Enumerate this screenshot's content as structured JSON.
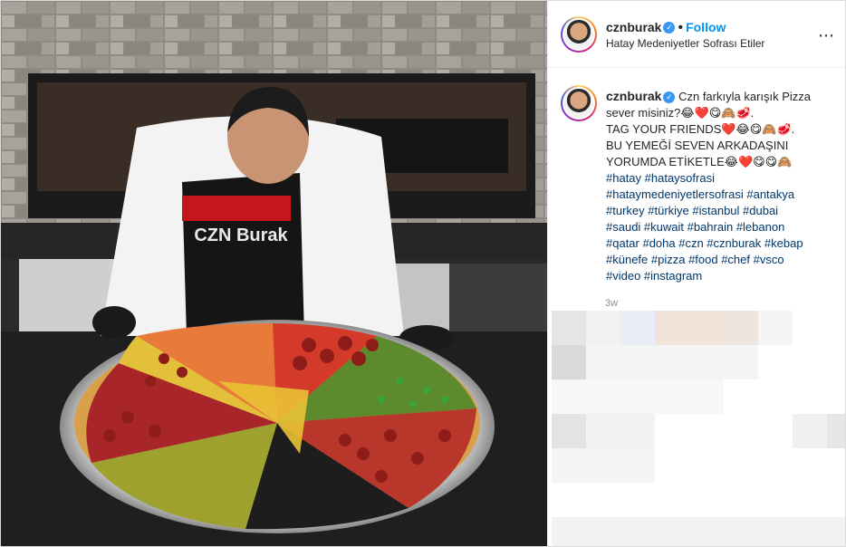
{
  "post": {
    "username": "cznburak",
    "follow_label": "Follow",
    "location": "Hatay Medeniyetler Sofrası Etiler",
    "more_icon": "⋯",
    "caption_lines": [
      "Czn farkıyla karışık Pizza",
      "sever misiniz?😂❤️😋🙈🥩.",
      "TAG YOUR FRIENDS❤️😂😋🙈🥩.",
      "BU YEMEĞİ SEVEN ARKADAŞINI",
      "YORUMDA ETİKETLE😂❤️😋😋🙈"
    ],
    "hashtag_lines": [
      "#hatay #hataysofrasi",
      "#hataymedeniyetlersofrasi #antakya",
      "#turkey #türkiye #istanbul #dubai",
      "#saudi #kuwait #bahrain #lebanon",
      "#qatar #doha #czn #cznburak #kebap",
      "#künefe #pizza #food #chef #vsco",
      "#video #instagram"
    ],
    "time_ago": "3w",
    "apron_text": "CZN Burak",
    "colors": {
      "link": "#0095f6",
      "hashtag": "#00376b",
      "verified": "#3897f0"
    }
  }
}
